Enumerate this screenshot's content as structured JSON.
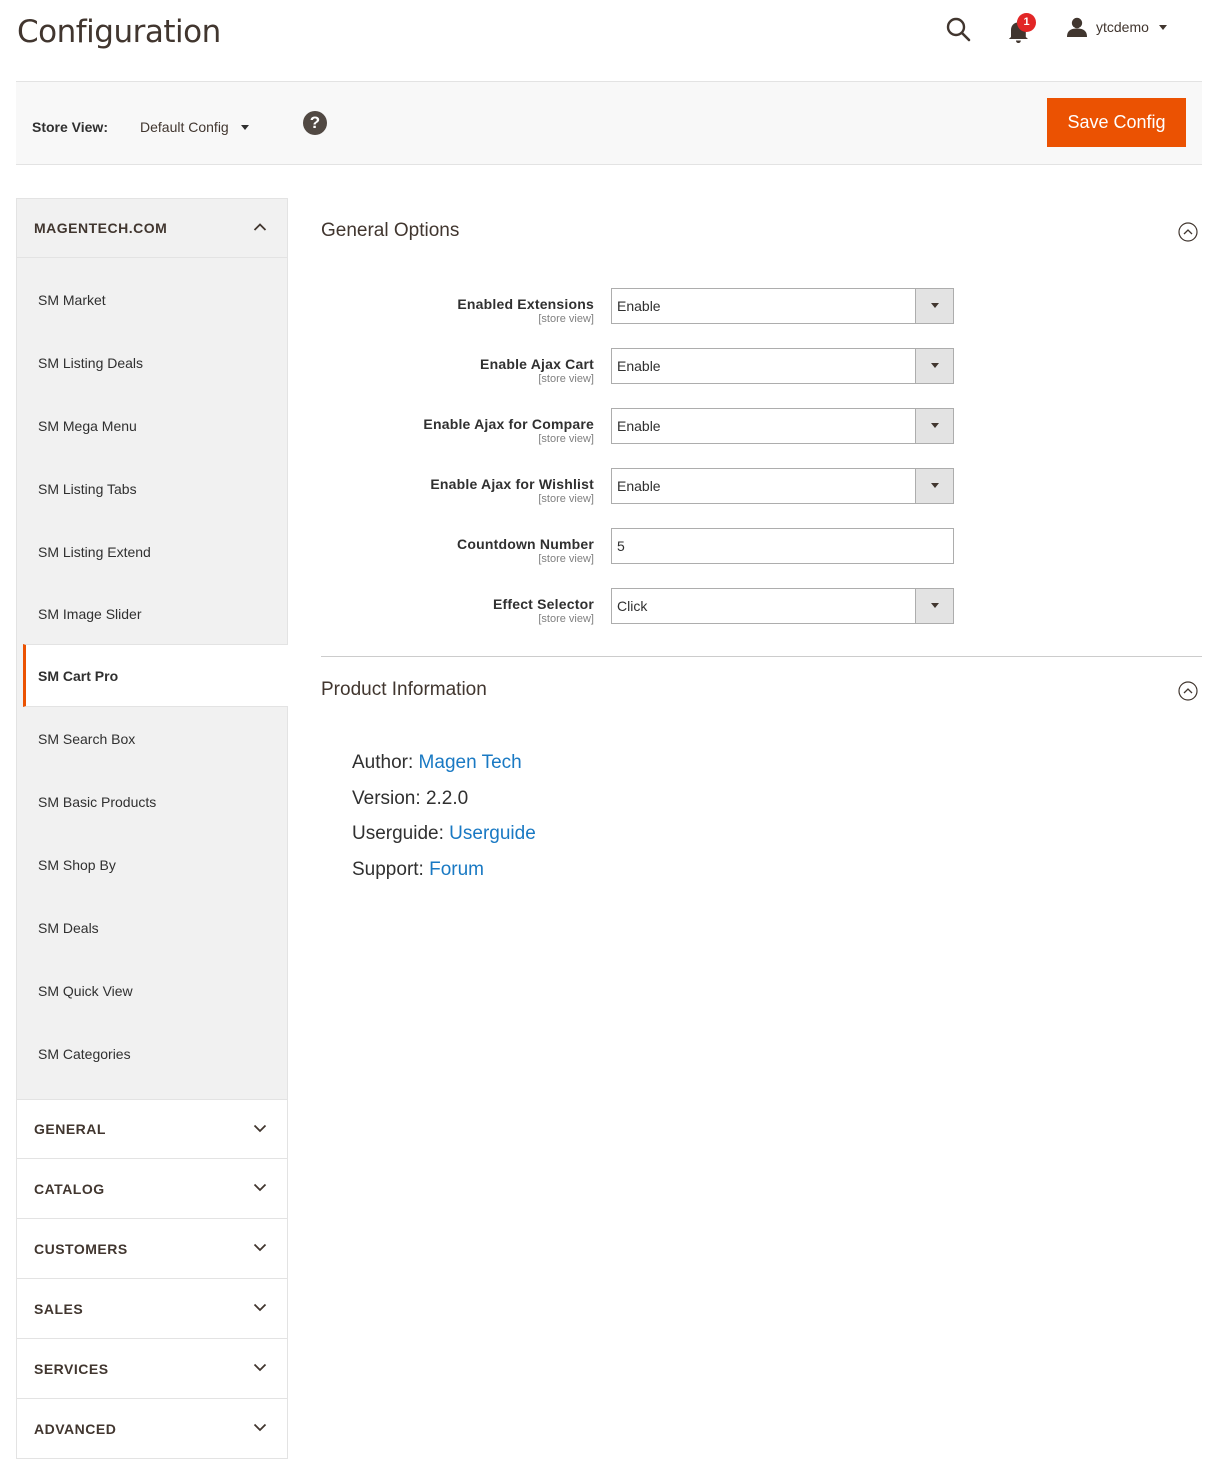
{
  "page": {
    "title": "Configuration"
  },
  "header": {
    "notifications_count": "1",
    "user_name": "ytcdemo",
    "icons": {
      "search": "search-icon",
      "notifications": "bell-icon",
      "user": "user-icon"
    }
  },
  "store_bar": {
    "label": "Store View:",
    "value": "Default Config",
    "help_icon_text": "?",
    "save_label": "Save Config"
  },
  "colors": {
    "accent": "#eb5202",
    "link": "#1979c3",
    "badge": "#e22626"
  },
  "sidebar": {
    "open_tab": {
      "title": "MAGENTECH.COM",
      "items": [
        {
          "label": "SM Market"
        },
        {
          "label": "SM Listing Deals"
        },
        {
          "label": "SM Mega Menu"
        },
        {
          "label": "SM Listing Tabs"
        },
        {
          "label": "SM Listing Extend"
        },
        {
          "label": "SM Image Slider"
        },
        {
          "label": "SM Cart Pro",
          "active": true
        },
        {
          "label": "SM Search Box"
        },
        {
          "label": "SM Basic Products"
        },
        {
          "label": "SM Shop By"
        },
        {
          "label": "SM Deals"
        },
        {
          "label": "SM Quick View"
        },
        {
          "label": "SM Categories"
        }
      ]
    },
    "collapsed_tabs": [
      {
        "title": "GENERAL"
      },
      {
        "title": "CATALOG"
      },
      {
        "title": "CUSTOMERS"
      },
      {
        "title": "SALES"
      },
      {
        "title": "SERVICES"
      },
      {
        "title": "ADVANCED"
      }
    ]
  },
  "general_options": {
    "title": "General Options",
    "fields": [
      {
        "label": "Enabled Extensions",
        "scope": "[store view]",
        "value": "Enable",
        "type": "select"
      },
      {
        "label": "Enable Ajax Cart",
        "scope": "[store view]",
        "value": "Enable",
        "type": "select"
      },
      {
        "label": "Enable Ajax for Compare",
        "scope": "[store view]",
        "value": "Enable",
        "type": "select"
      },
      {
        "label": "Enable Ajax for Wishlist",
        "scope": "[store view]",
        "value": "Enable",
        "type": "select"
      },
      {
        "label": "Countdown Number",
        "scope": "[store view]",
        "value": "5",
        "type": "text"
      },
      {
        "label": "Effect Selector",
        "scope": "[store view]",
        "value": "Click",
        "type": "select"
      }
    ]
  },
  "product_information": {
    "title": "Product Information",
    "author_label": "Author:",
    "author_value": "Magen Tech",
    "version_label": "Version:",
    "version_value": "2.2.0",
    "userguide_label": "Userguide:",
    "userguide_value": "Userguide",
    "support_label": "Support:",
    "support_value": "Forum"
  }
}
